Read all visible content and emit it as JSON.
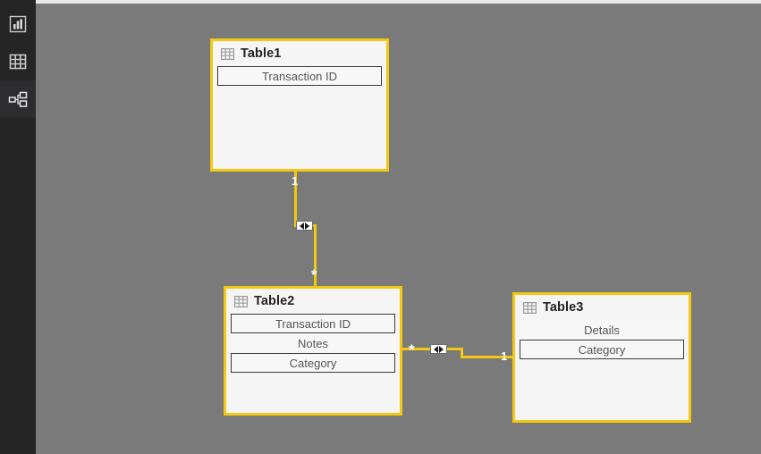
{
  "app": {
    "view_name": "Model view",
    "canvas_color": "#7a7a7a",
    "accent_color": "#f2c811"
  },
  "sidebar": {
    "items": [
      {
        "id": "report-view",
        "label": "Report",
        "icon": "bar-chart-icon",
        "selected": false
      },
      {
        "id": "data-view",
        "label": "Data",
        "icon": "table-grid-icon",
        "selected": false
      },
      {
        "id": "model-view",
        "label": "Model",
        "icon": "model-relationship-icon",
        "selected": true
      }
    ]
  },
  "tables": [
    {
      "id": "table1",
      "name": "Table1",
      "icon": "table-icon",
      "fields": [
        {
          "name": "Transaction ID",
          "boxed": true
        }
      ]
    },
    {
      "id": "table2",
      "name": "Table2",
      "icon": "table-icon",
      "fields": [
        {
          "name": "Transaction ID",
          "boxed": true
        },
        {
          "name": "Notes",
          "boxed": false
        },
        {
          "name": "Category",
          "boxed": true
        }
      ]
    },
    {
      "id": "table3",
      "name": "Table3",
      "icon": "table-icon",
      "fields": [
        {
          "name": "Details",
          "boxed": false
        },
        {
          "name": "Category",
          "boxed": true
        }
      ]
    }
  ],
  "relationships": [
    {
      "id": "rel-table1-table2",
      "from_table": "Table1",
      "from_field": "Transaction ID",
      "to_table": "Table2",
      "to_field": "Transaction ID",
      "from_cardinality": "1",
      "to_cardinality": "*",
      "cross_filter": "both",
      "filter_icon": "bidirectional-filter-icon"
    },
    {
      "id": "rel-table2-table3",
      "from_table": "Table2",
      "from_field": "Category",
      "to_table": "Table3",
      "to_field": "Category",
      "from_cardinality": "*",
      "to_cardinality": "1",
      "cross_filter": "both",
      "filter_icon": "bidirectional-filter-icon"
    }
  ]
}
